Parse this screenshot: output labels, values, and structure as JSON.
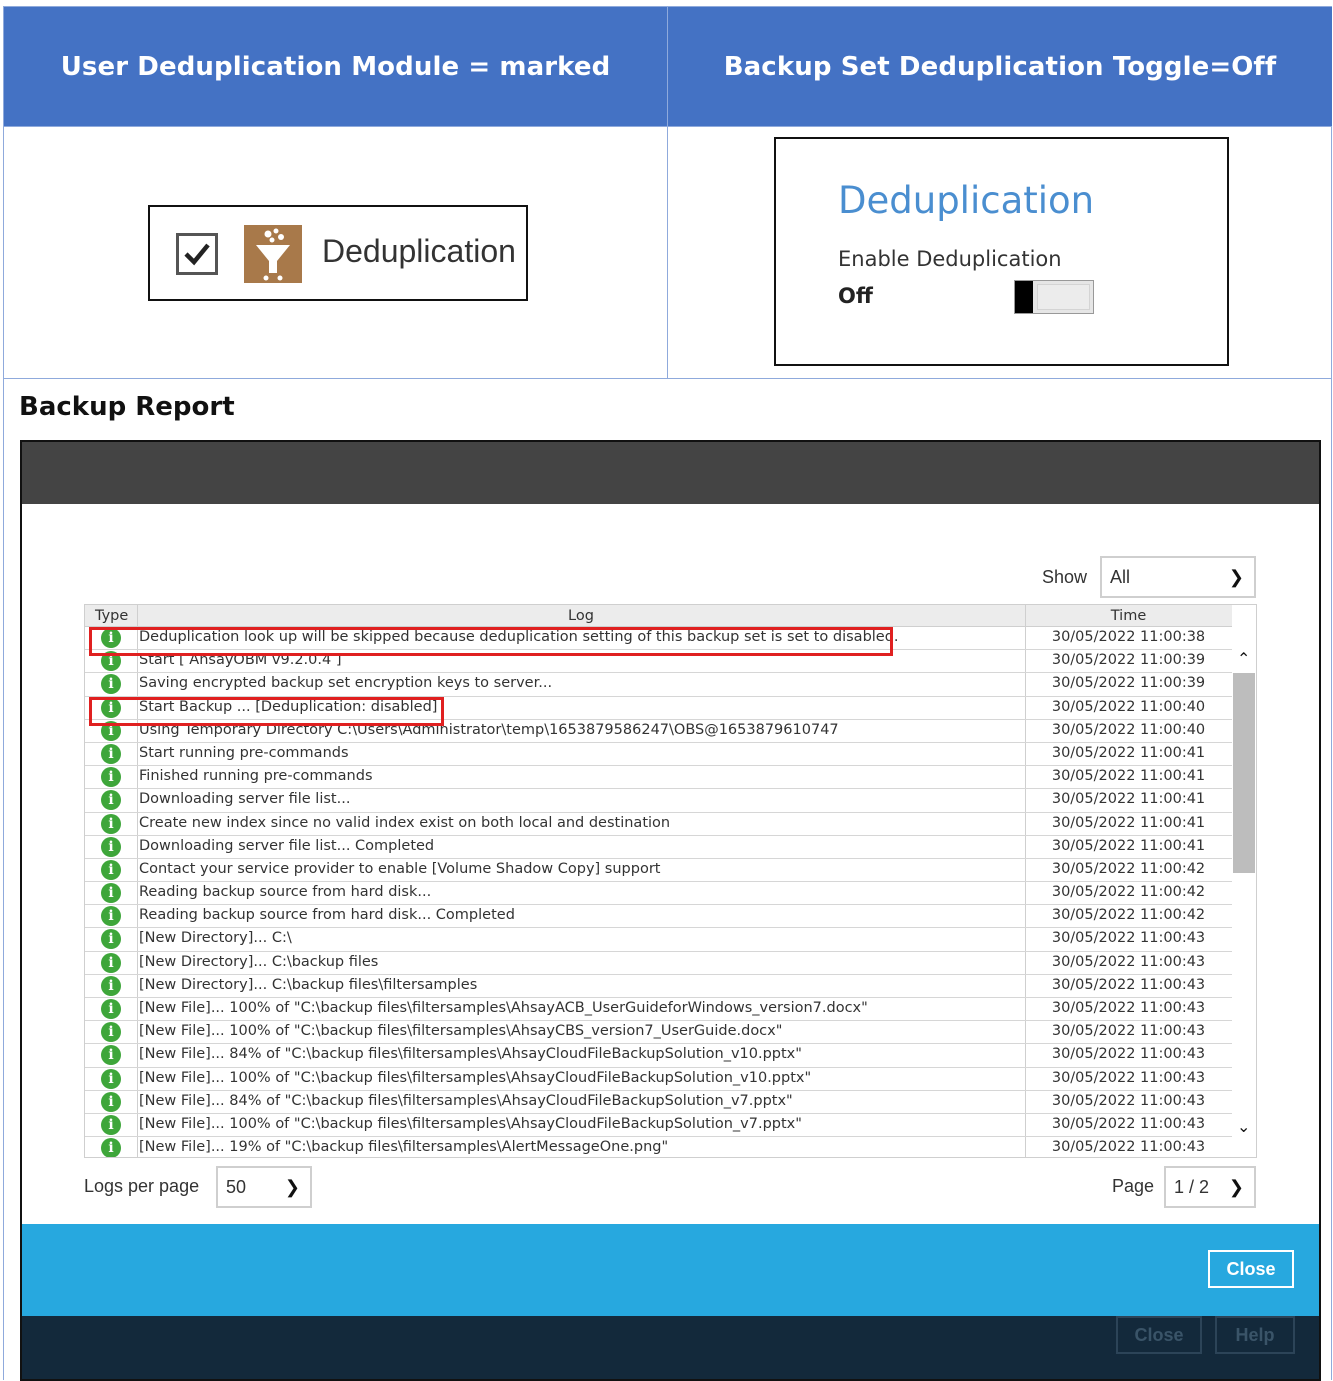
{
  "header": {
    "left": "User Deduplication Module = marked",
    "right": "Backup Set Deduplication Toggle=Off"
  },
  "module": {
    "checked": true,
    "label": "Deduplication"
  },
  "toggle": {
    "title": "Deduplication",
    "subtitle": "Enable Deduplication",
    "state": "Off"
  },
  "report": {
    "heading": "Backup Report",
    "show_label": "Show",
    "show_value": "All",
    "columns": {
      "type": "Type",
      "log": "Log",
      "time": "Time"
    },
    "rows": [
      {
        "log": "Deduplication look up will be skipped because deduplication setting of this backup set is set to disabled.",
        "time": "30/05/2022 11:00:38"
      },
      {
        "log": "Start [ AhsayOBM v9.2.0.4 ]",
        "time": "30/05/2022 11:00:39"
      },
      {
        "log": "Saving encrypted backup set encryption keys to server...",
        "time": "30/05/2022 11:00:39"
      },
      {
        "log": "Start Backup ... [Deduplication: disabled]",
        "time": "30/05/2022 11:00:40"
      },
      {
        "log": "Using Temporary Directory C:\\Users\\Administrator\\temp\\1653879586247\\OBS@1653879610747",
        "time": "30/05/2022 11:00:40"
      },
      {
        "log": "Start running pre-commands",
        "time": "30/05/2022 11:00:41"
      },
      {
        "log": "Finished running pre-commands",
        "time": "30/05/2022 11:00:41"
      },
      {
        "log": "Downloading server file list...",
        "time": "30/05/2022 11:00:41"
      },
      {
        "log": "Create new index since no valid index exist on both local and destination",
        "time": "30/05/2022 11:00:41"
      },
      {
        "log": "Downloading server file list... Completed",
        "time": "30/05/2022 11:00:41"
      },
      {
        "log": "Contact your service provider to enable [Volume Shadow Copy] support",
        "time": "30/05/2022 11:00:42"
      },
      {
        "log": "Reading backup source from hard disk...",
        "time": "30/05/2022 11:00:42"
      },
      {
        "log": "Reading backup source from hard disk... Completed",
        "time": "30/05/2022 11:00:42"
      },
      {
        "log": "[New Directory]... C:\\",
        "time": "30/05/2022 11:00:43"
      },
      {
        "log": "[New Directory]... C:\\backup files",
        "time": "30/05/2022 11:00:43"
      },
      {
        "log": "[New Directory]... C:\\backup files\\filtersamples",
        "time": "30/05/2022 11:00:43"
      },
      {
        "log": "[New File]... 100% of \"C:\\backup files\\filtersamples\\AhsayACB_UserGuideforWindows_version7.docx\"",
        "time": "30/05/2022 11:00:43"
      },
      {
        "log": "[New File]... 100% of \"C:\\backup files\\filtersamples\\AhsayCBS_version7_UserGuide.docx\"",
        "time": "30/05/2022 11:00:43"
      },
      {
        "log": "[New File]... 84% of \"C:\\backup files\\filtersamples\\AhsayCloudFileBackupSolution_v10.pptx\"",
        "time": "30/05/2022 11:00:43"
      },
      {
        "log": "[New File]... 100% of \"C:\\backup files\\filtersamples\\AhsayCloudFileBackupSolution_v10.pptx\"",
        "time": "30/05/2022 11:00:43"
      },
      {
        "log": "[New File]... 84% of \"C:\\backup files\\filtersamples\\AhsayCloudFileBackupSolution_v7.pptx\"",
        "time": "30/05/2022 11:00:43"
      },
      {
        "log": "[New File]... 100% of \"C:\\backup files\\filtersamples\\AhsayCloudFileBackupSolution_v7.pptx\"",
        "time": "30/05/2022 11:00:43"
      },
      {
        "log": "[New File]... 19% of \"C:\\backup files\\filtersamples\\AlertMessageOne.png\"",
        "time": "30/05/2022 11:00:43"
      }
    ],
    "logs_per_page_label": "Logs per page",
    "logs_per_page_value": "50",
    "page_label": "Page",
    "page_value": "1 / 2",
    "close_label": "Close",
    "ghost_close_label": "Close",
    "help_label": "Help"
  },
  "colors": {
    "header_bg": "#4472c4",
    "accent_blue": "#27a8df",
    "footer_dark": "#13293b",
    "info_green": "#3ea63a",
    "highlight_red": "#e02020"
  }
}
